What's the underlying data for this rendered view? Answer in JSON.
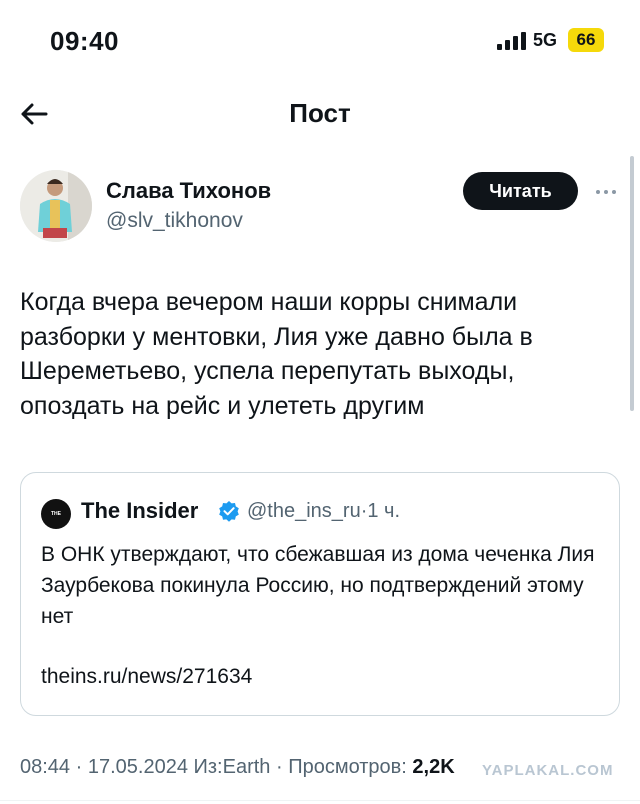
{
  "status_bar": {
    "time": "09:40",
    "network": "5G",
    "battery": "66"
  },
  "nav": {
    "title": "Пост"
  },
  "author": {
    "name": "Слава Тихонов",
    "handle": "@slv_tikhonov",
    "follow_label": "Читать"
  },
  "tweet": {
    "text": "Когда вчера вечером наши корры снимали разборки у ментовки, Лия уже давно была в Шереметьево, успела перепутать выходы, опоздать на рейс и улететь другим"
  },
  "quote": {
    "logo_text": "THE INSIDER",
    "name": "The Insider",
    "handle": "@the_ins_ru",
    "time": "1 ч.",
    "text": "В ОНК утверждают, что сбежавшая из дома чеченка Лия Заурбекова покинула Россию, но подтверждений этому нет",
    "link": "theins.ru/news/271634"
  },
  "meta": {
    "time": "08:44",
    "date": "17.05.2024",
    "source": "Из:Earth",
    "views_label": "Просмотров:",
    "views": "2,2K"
  },
  "watermark": "YAPLAKAL.COM",
  "colors": {
    "accent_verified": "#1d9bf0",
    "battery": "#f5d90a",
    "text": "#0f1419",
    "muted": "#536471"
  }
}
